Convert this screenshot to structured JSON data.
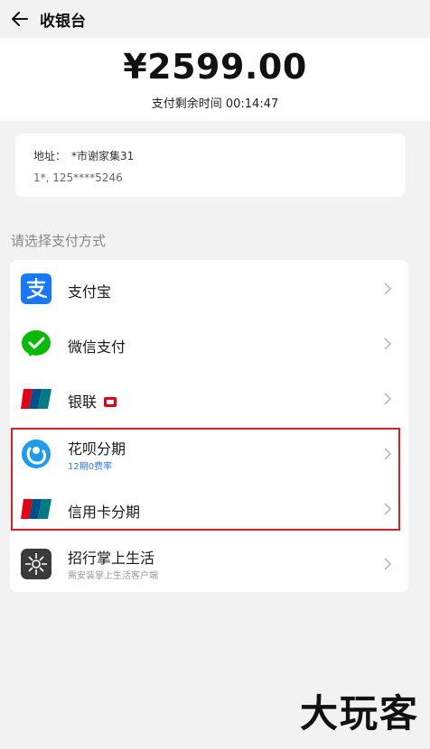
{
  "header": {
    "title": "收银台",
    "back_icon": "arrow-left-icon"
  },
  "payment": {
    "amount": "¥2599.00",
    "countdown": "支付剩余时间 00:14:47"
  },
  "address": {
    "label": "地址：",
    "value": "*市谢家集31",
    "contact": "1*, 125****5246"
  },
  "section_title": "请选择支付方式",
  "methods": [
    {
      "name": "支付宝",
      "sub": "",
      "icon": "alipay-icon"
    },
    {
      "name": "微信支付",
      "sub": "",
      "icon": "wechat-pay-icon"
    },
    {
      "name": "银联",
      "sub": "",
      "icon": "unionpay-icon",
      "badge": "red-card-badge"
    },
    {
      "name": "花呗分期",
      "sub": "12期0费率",
      "icon": "huabei-icon"
    },
    {
      "name": "信用卡分期",
      "sub": "",
      "icon": "unionpay-icon"
    },
    {
      "name": "招行掌上生活",
      "sub": "需安装掌上生活客户端",
      "icon": "cmb-life-icon"
    }
  ],
  "colors": {
    "alipay": "#1677ff",
    "wechat": "#09bb07",
    "unionpay_red": "#e60012",
    "unionpay_blue": "#00508e",
    "unionpay_teal": "#007b84",
    "huabei": "#1e9bf0",
    "highlight": "#e02020",
    "sub_blue": "#2f7be5"
  },
  "watermark": "大玩客"
}
